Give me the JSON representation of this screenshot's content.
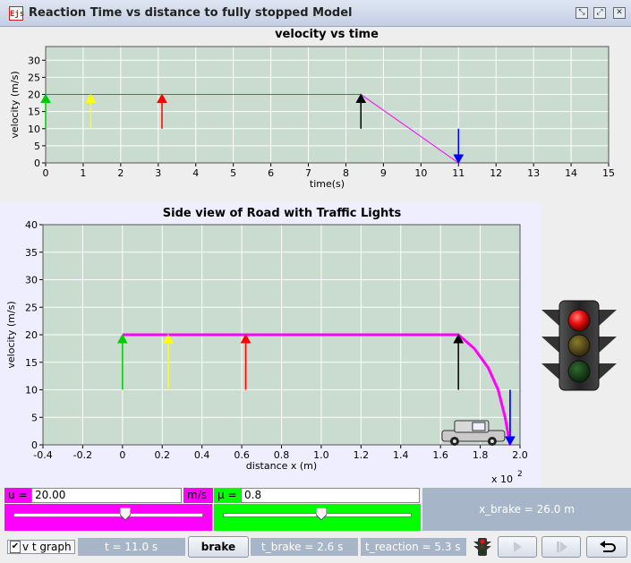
{
  "window": {
    "title": "Reaction Time vs distance to fully stopped Model",
    "icon_text": "Ejs"
  },
  "vt_plot": {
    "title": "velocity vs time",
    "xlabel": "time(s)",
    "ylabel": "velocity (m/s)",
    "xticks": [
      "0",
      "1",
      "2",
      "3",
      "4",
      "5",
      "6",
      "7",
      "8",
      "9",
      "10",
      "11",
      "12",
      "13",
      "14",
      "15"
    ],
    "yticks": [
      "0",
      "5",
      "10",
      "15",
      "20",
      "25",
      "30"
    ],
    "xlim": [
      0,
      15
    ],
    "ylim": [
      0,
      34
    ],
    "colors": {
      "background": "#c9dccf",
      "curve": "#ff00ff"
    }
  },
  "road_plot": {
    "title": "Side view of Road with Traffic Lights",
    "xlabel": "distance x (m)",
    "ylabel": "velocity (m/s)",
    "xticks": [
      "-0.4",
      "-0.2",
      "0",
      "0.2",
      "0.4",
      "0.6",
      "0.8",
      "1.0",
      "1.2",
      "1.4",
      "1.6",
      "1.8",
      "2.0"
    ],
    "yticks": [
      "0",
      "5",
      "10",
      "15",
      "20",
      "25",
      "30",
      "35",
      "40"
    ],
    "xlim": [
      -0.4,
      2.0
    ],
    "ylim": [
      0,
      40
    ],
    "x_scale_label": "x 10",
    "x_scale_exp": "2",
    "colors": {
      "background": "#c9dccf",
      "curve": "#ff00ff"
    }
  },
  "chart_data": [
    {
      "type": "line",
      "title": "velocity vs time",
      "xlabel": "time(s)",
      "ylabel": "velocity (m/s)",
      "xlim": [
        0,
        15
      ],
      "ylim": [
        0,
        34
      ],
      "series": [
        {
          "x": [
            0,
            8.4,
            11.0
          ],
          "y": [
            20,
            20,
            0
          ],
          "color": "#ff00ff"
        }
      ],
      "markers": [
        {
          "x": 0,
          "color": "#00cc00",
          "from": 10,
          "to": 20
        },
        {
          "x": 1.2,
          "color": "#ffff00",
          "from": 10,
          "to": 20
        },
        {
          "x": 3.1,
          "color": "#ff0000",
          "from": 10,
          "to": 20
        },
        {
          "x": 8.4,
          "color": "#000000",
          "from": 10,
          "to": 20
        },
        {
          "x": 11.0,
          "color": "#0000ff",
          "from": 10,
          "to": 0
        }
      ]
    },
    {
      "type": "line",
      "title": "Side view of Road with Traffic Lights",
      "xlabel": "distance x (m)",
      "ylabel": "velocity (m/s)",
      "xlim": [
        -0.4,
        2.0
      ],
      "ylim": [
        0,
        40
      ],
      "series": [
        {
          "x": [
            0,
            1.69,
            1.77,
            1.84,
            1.89,
            1.925,
            1.95
          ],
          "y": [
            20,
            20,
            17.5,
            14,
            10,
            5,
            0
          ],
          "color": "#ff00ff"
        }
      ],
      "markers": [
        {
          "x": 0,
          "color": "#00cc00",
          "from": 10,
          "to": 20
        },
        {
          "x": 0.23,
          "color": "#ffff00",
          "from": 10,
          "to": 20
        },
        {
          "x": 0.62,
          "color": "#ff0000",
          "from": 10,
          "to": 20
        },
        {
          "x": 1.69,
          "color": "#000000",
          "from": 10,
          "to": 20
        },
        {
          "x": 1.95,
          "color": "#0000ff",
          "from": 10,
          "to": 0
        }
      ]
    }
  ],
  "controls": {
    "u_label": "u =",
    "u_value": "20.00",
    "u_unit": "m/s",
    "u_slider_fraction": 0.59,
    "mu_label": "μ =",
    "mu_value": "0.8",
    "mu_slider_fraction": 0.52,
    "x_brake": "x_brake = 26.0 m"
  },
  "bottom": {
    "checkbox_label": "v t graph",
    "checkbox_checked": true,
    "t": "t = 11.0 s",
    "brake_button": "brake",
    "t_brake": "t_brake = 2.6 s",
    "t_reaction": "t_reaction = 5.3 s"
  },
  "colors": {
    "magenta": "#ff00ff",
    "green": "#00ff00",
    "accent_panel": "#a7b5c9",
    "traffic_light_active": "#ff0000"
  }
}
